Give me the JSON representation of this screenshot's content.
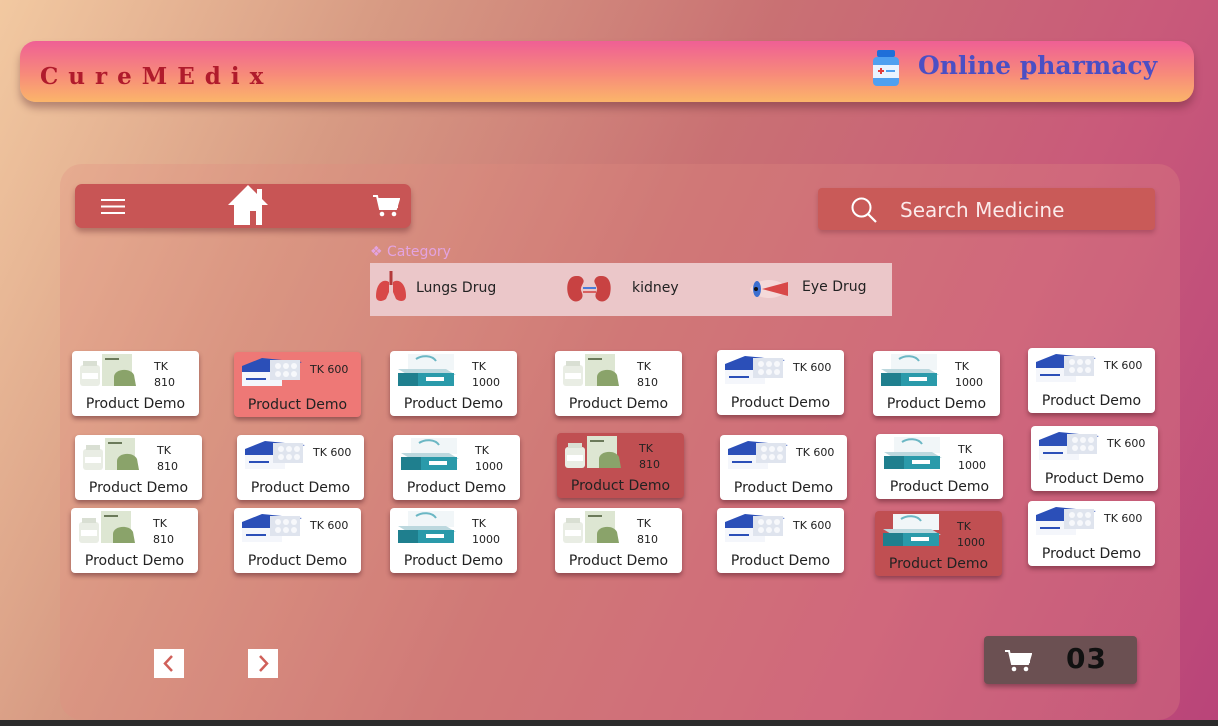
{
  "header": {
    "brand": "CureMEdix",
    "tagline": "Online pharmacy"
  },
  "navbar": {
    "menu_icon": "hamburger-icon",
    "home_icon": "home-icon",
    "cart_icon": "cart-icon"
  },
  "search": {
    "label": "Search Medicine",
    "icon": "search-icon"
  },
  "category": {
    "title": "❖ Category",
    "items": [
      {
        "label": "Lungs Drug",
        "icon": "lungs-icon"
      },
      {
        "label": "kidney",
        "icon": "kidney-icon"
      },
      {
        "label": "Eye Drug",
        "icon": "eye-icon"
      }
    ]
  },
  "products": [
    {
      "price_l1": "TK",
      "price_l2": "810",
      "name": "Product Demo",
      "thumb": "bottle-box",
      "state": "normal"
    },
    {
      "price_l1": "TK 600",
      "price_l2": "",
      "name": "Product Demo",
      "thumb": "blue-blister",
      "state": "selected-pink"
    },
    {
      "price_l1": "TK",
      "price_l2": "1000",
      "name": "Product Demo",
      "thumb": "teal-box",
      "state": "normal"
    },
    {
      "price_l1": "TK",
      "price_l2": "810",
      "name": "Product Demo",
      "thumb": "bottle-box",
      "state": "normal"
    },
    {
      "price_l1": "TK 600",
      "price_l2": "",
      "name": "Product Demo",
      "thumb": "blue-blister",
      "state": "normal"
    },
    {
      "price_l1": "TK",
      "price_l2": "1000",
      "name": "Product Demo",
      "thumb": "teal-box",
      "state": "normal"
    },
    {
      "price_l1": "TK 600",
      "price_l2": "",
      "name": "Product Demo",
      "thumb": "blue-blister",
      "state": "normal"
    },
    {
      "price_l1": "TK",
      "price_l2": "810",
      "name": "Product Demo",
      "thumb": "bottle-box",
      "state": "normal"
    },
    {
      "price_l1": "TK 600",
      "price_l2": "",
      "name": "Product Demo",
      "thumb": "blue-blister",
      "state": "normal"
    },
    {
      "price_l1": "TK",
      "price_l2": "1000",
      "name": "Product Demo",
      "thumb": "teal-box",
      "state": "normal"
    },
    {
      "price_l1": "TK",
      "price_l2": "810",
      "name": "Product Demo",
      "thumb": "bottle-box",
      "state": "selected-dark"
    },
    {
      "price_l1": "TK 600",
      "price_l2": "",
      "name": "Product Demo",
      "thumb": "blue-blister",
      "state": "normal"
    },
    {
      "price_l1": "TK",
      "price_l2": "1000",
      "name": "Product Demo",
      "thumb": "teal-box",
      "state": "normal"
    },
    {
      "price_l1": "TK 600",
      "price_l2": "",
      "name": "Product Demo",
      "thumb": "blue-blister",
      "state": "normal"
    },
    {
      "price_l1": "TK",
      "price_l2": "810",
      "name": "Product Demo",
      "thumb": "bottle-box",
      "state": "normal"
    },
    {
      "price_l1": "TK 600",
      "price_l2": "",
      "name": "Product Demo",
      "thumb": "blue-blister",
      "state": "normal"
    },
    {
      "price_l1": "TK",
      "price_l2": "1000",
      "name": "Product Demo",
      "thumb": "teal-box",
      "state": "normal"
    },
    {
      "price_l1": "TK",
      "price_l2": "810",
      "name": "Product Demo",
      "thumb": "bottle-box",
      "state": "normal"
    },
    {
      "price_l1": "TK 600",
      "price_l2": "",
      "name": "Product Demo",
      "thumb": "blue-blister",
      "state": "normal"
    },
    {
      "price_l1": "TK",
      "price_l2": "1000",
      "name": "Product Demo",
      "thumb": "teal-box",
      "state": "selected-dark"
    },
    {
      "price_l1": "TK 600",
      "price_l2": "",
      "name": "Product Demo",
      "thumb": "blue-blister",
      "state": "normal"
    }
  ],
  "pagination": {
    "prev_icon": "chevron-left-icon",
    "next_icon": "chevron-right-icon"
  },
  "cart": {
    "count": "03",
    "icon": "cart-icon"
  },
  "colors": {
    "brand": "#b01b2c",
    "tagline": "#4b4fc4",
    "navbar": "#c85555",
    "card_selected_pink": "#ee7876",
    "card_selected_dark": "#c04f52"
  }
}
